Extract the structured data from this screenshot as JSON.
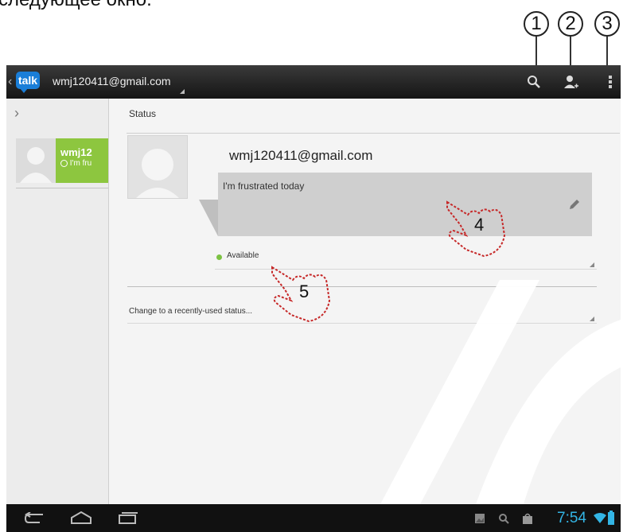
{
  "caption": "следующее окно.",
  "callouts": [
    "1",
    "2",
    "3",
    "4",
    "5"
  ],
  "app": {
    "logo_text": "talk",
    "account": "wmj120411@gmail.com"
  },
  "contact": {
    "name": "wmj12",
    "status_snippet": "I'm fru"
  },
  "status": {
    "heading": "Status",
    "email": "wmj120411@gmail.com",
    "message": "I'm frustrated today",
    "availability": "Available",
    "recent_label": "Change to a recently-used status..."
  },
  "system_bar": {
    "time": "7:54"
  },
  "colors": {
    "accent_green": "#8dc63f",
    "clock_blue": "#33b5e5",
    "actionbar": "#1c1c1c"
  },
  "icons": [
    "search-icon",
    "add-person-icon",
    "overflow-menu-icon",
    "edit-pencil-icon",
    "back-icon",
    "home-icon",
    "recent-apps-icon",
    "gallery-icon",
    "battery-icon",
    "wifi-icon"
  ]
}
